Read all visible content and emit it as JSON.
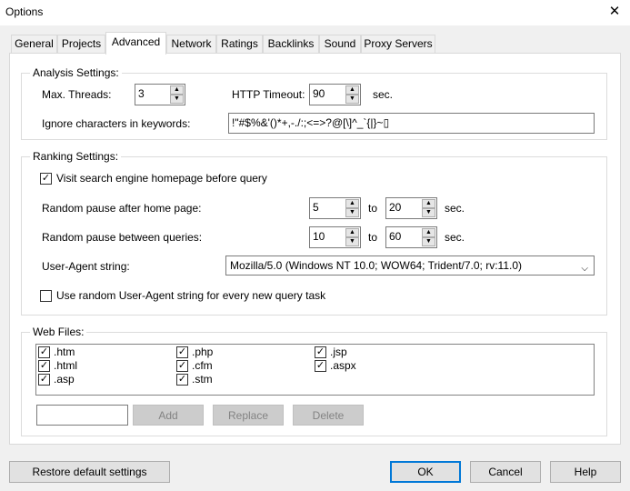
{
  "window": {
    "title": "Options",
    "close_glyph": "✕"
  },
  "tabs": [
    {
      "label": "General",
      "active": false
    },
    {
      "label": "Projects",
      "active": false
    },
    {
      "label": "Advanced",
      "active": true
    },
    {
      "label": "Network",
      "active": false
    },
    {
      "label": "Ratings",
      "active": false
    },
    {
      "label": "Backlinks",
      "active": false
    },
    {
      "label": "Sound",
      "active": false
    },
    {
      "label": "Proxy Servers",
      "active": false
    }
  ],
  "analysis": {
    "legend": "Analysis Settings:",
    "max_threads_label": "Max. Threads:",
    "max_threads_value": "3",
    "http_timeout_label": "HTTP Timeout:",
    "http_timeout_value": "90",
    "http_timeout_unit": "sec.",
    "ignore_chars_label": "Ignore characters in keywords:",
    "ignore_chars_value": "!\"#$%&'()*+,-./:;<=>?@[\\]^_`{|}~▯"
  },
  "ranking": {
    "legend": "Ranking Settings:",
    "visit_homepage_label": "Visit search engine homepage before query",
    "visit_homepage_checked": true,
    "pause_home_label": "Random pause after home page:",
    "pause_home_min": "5",
    "pause_home_max": "20",
    "pause_queries_label": "Random pause between queries:",
    "pause_queries_min": "10",
    "pause_queries_max": "60",
    "to_label": "to",
    "unit": "sec.",
    "user_agent_label": "User-Agent string:",
    "user_agent_value": "Mozilla/5.0 (Windows NT 10.0; WOW64; Trident/7.0; rv:11.0)",
    "random_ua_label": "Use random User-Agent string for every new query task",
    "random_ua_checked": false
  },
  "web_files": {
    "legend": "Web Files:",
    "items": [
      {
        "ext": ".htm",
        "checked": true
      },
      {
        "ext": ".html",
        "checked": true
      },
      {
        "ext": ".asp",
        "checked": true
      },
      {
        "ext": ".php",
        "checked": true
      },
      {
        "ext": ".cfm",
        "checked": true
      },
      {
        "ext": ".stm",
        "checked": true
      },
      {
        "ext": ".jsp",
        "checked": true
      },
      {
        "ext": ".aspx",
        "checked": true
      }
    ],
    "new_ext_value": "",
    "add_label": "Add",
    "replace_label": "Replace",
    "delete_label": "Delete"
  },
  "footer": {
    "restore_label": "Restore default settings",
    "ok_label": "OK",
    "cancel_label": "Cancel",
    "help_label": "Help"
  },
  "colors": {
    "accent": "#0078d7",
    "panel": "#ffffff",
    "window": "#f0f0f0"
  },
  "glyphs": {
    "check": "✓",
    "up": "▲",
    "down": "▼",
    "dropdown": "⌵"
  }
}
